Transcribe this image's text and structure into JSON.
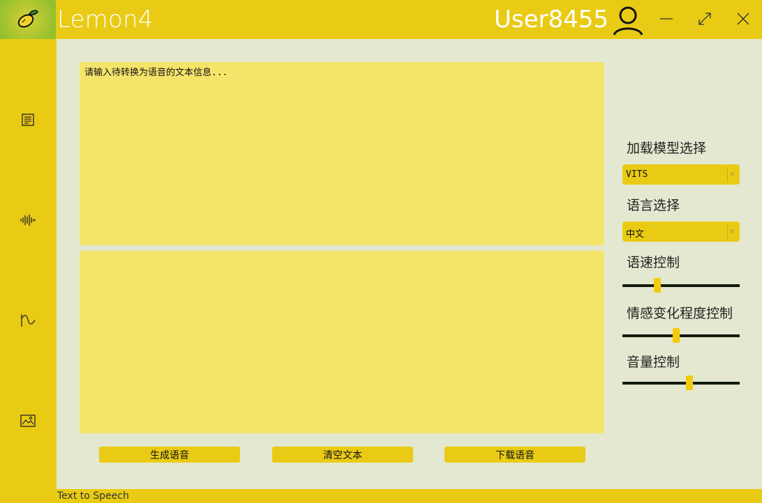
{
  "app": {
    "title": "Lemon4",
    "user_name": "User8455"
  },
  "window_controls": [
    "minimize",
    "maximize",
    "close"
  ],
  "sidebar": {
    "items": [
      {
        "icon": "document-icon"
      },
      {
        "icon": "waveform-icon"
      },
      {
        "icon": "curve-icon"
      },
      {
        "icon": "image-icon"
      }
    ]
  },
  "main": {
    "input_placeholder": "请输入待转换为语音的文本信息...",
    "buttons": {
      "generate": "生成语音",
      "clear": "清空文本",
      "download": "下载语音"
    }
  },
  "panel": {
    "model_label": "加载模型选择",
    "model_value": "VITS",
    "language_label": "语言选择",
    "language_value": "中文",
    "speed_label": "语速控制",
    "speed_value": 0.3,
    "emotion_label": "情感变化程度控制",
    "emotion_value": 0.46,
    "volume_label": "音量控制",
    "volume_value": 0.57
  },
  "status": {
    "text": "Text to Speech"
  },
  "colors": {
    "accent": "#e9cb15",
    "content_bg": "#e4e8d0",
    "textarea_bg": "#f4e46a",
    "slider_thumb": "#f2cb0c",
    "slider_track": "#111a0c"
  }
}
